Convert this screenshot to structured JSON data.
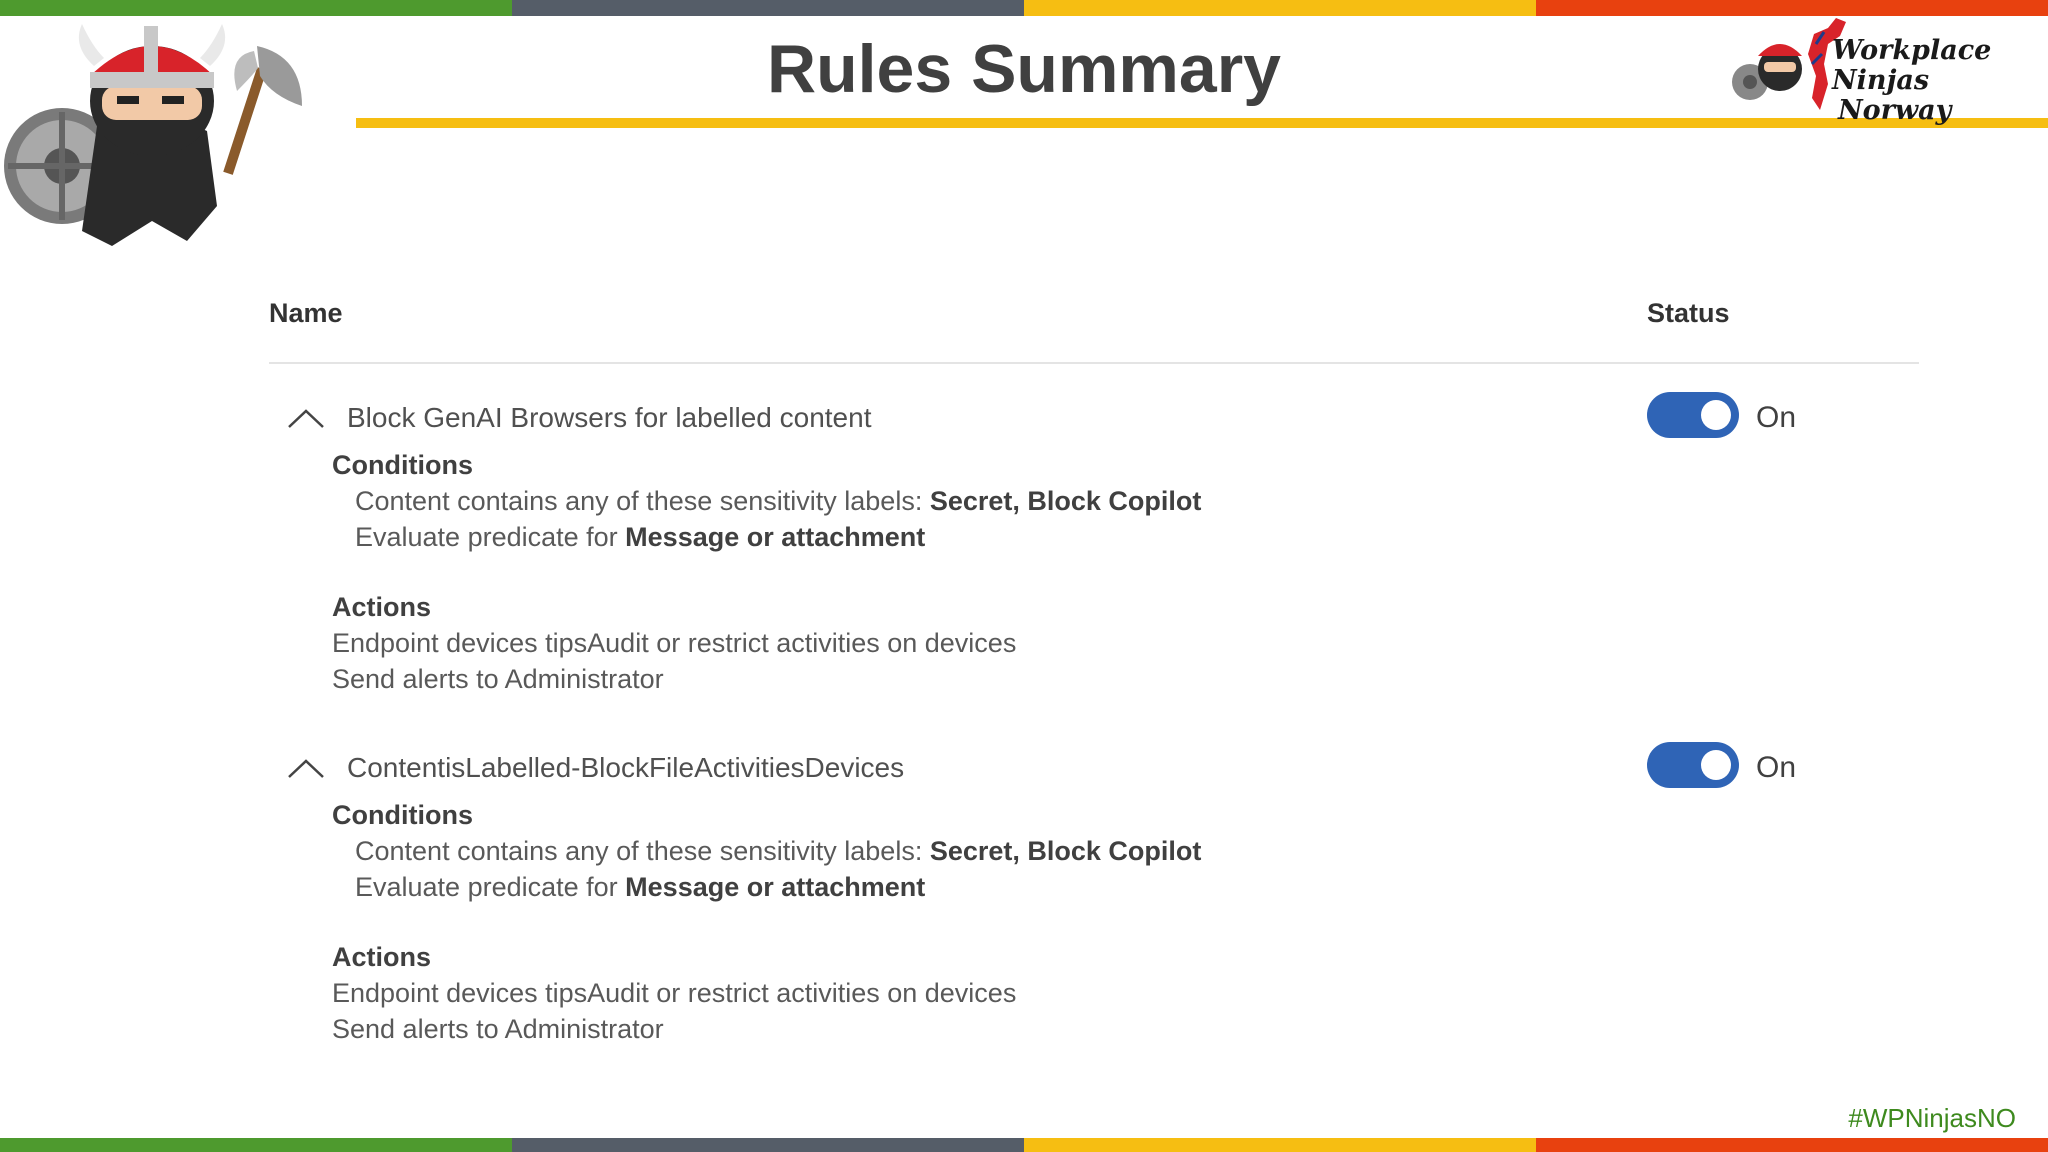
{
  "slide": {
    "title": "Rules Summary",
    "brand_line1": "Workplace Ninjas",
    "brand_line2": "Norway",
    "hashtag": "#WPNinjasNO"
  },
  "table": {
    "col_name": "Name",
    "col_status": "Status"
  },
  "rules": [
    {
      "name": "Block GenAI Browsers for labelled content",
      "status": "On",
      "conditions_title": "Conditions",
      "cond1_text": "Content contains any of these sensitivity labels: ",
      "cond1_bold": "Secret, Block Copilot",
      "cond2_text": "Evaluate predicate for ",
      "cond2_bold": "Message or attachment",
      "actions_title": "Actions",
      "action1": "Endpoint devices tipsAudit or restrict activities on devices",
      "action2": "Send alerts to Administrator"
    },
    {
      "name": "ContentisLabelled-BlockFileActivitiesDevices",
      "status": "On",
      "conditions_title": "Conditions",
      "cond1_text": "Content contains any of these sensitivity labels: ",
      "cond1_bold": "Secret, Block Copilot",
      "cond2_text": "Evaluate predicate for ",
      "cond2_bold": "Message or attachment",
      "actions_title": "Actions",
      "action1": "Endpoint devices tipsAudit or restrict activities on devices",
      "action2": "Send alerts to Administrator"
    }
  ],
  "colors": {
    "toggle_on": "#2f64b6",
    "accent_yellow": "#f6be12",
    "stripe_green": "#4e9a2e",
    "stripe_gray": "#555d68",
    "stripe_orange": "#e8410f"
  }
}
